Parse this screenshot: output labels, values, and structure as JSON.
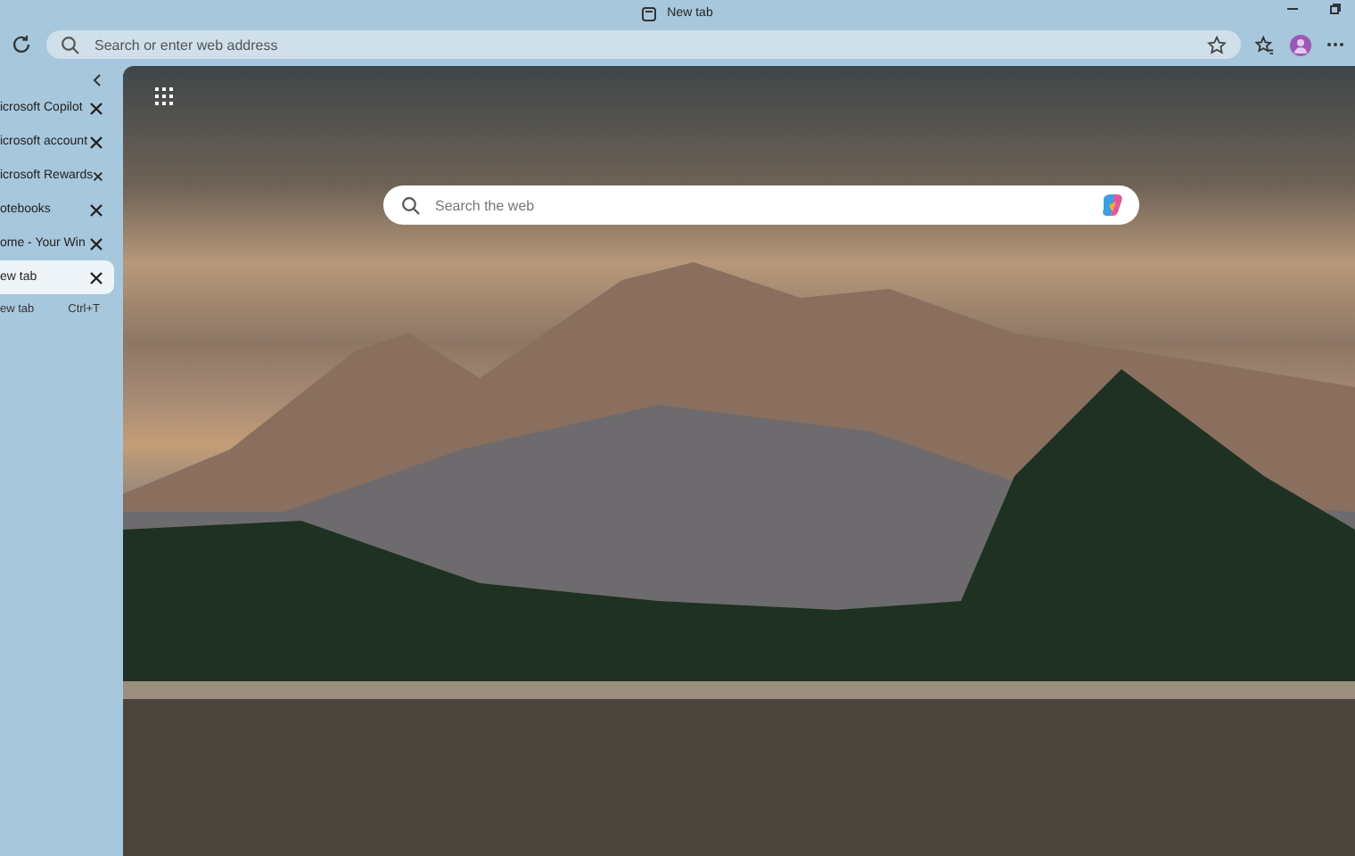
{
  "window": {
    "title": "New tab"
  },
  "address_bar": {
    "placeholder": "Search or enter web address"
  },
  "tabs": [
    {
      "label": "icrosoft Copilot",
      "selected": false
    },
    {
      "label": "icrosoft account",
      "selected": false
    },
    {
      "label": "icrosoft Rewards",
      "selected": false
    },
    {
      "label": "otebooks",
      "selected": false
    },
    {
      "label": "ome - Your Win",
      "selected": false
    },
    {
      "label": "ew tab",
      "selected": true
    }
  ],
  "new_tab": {
    "label": "ew tab",
    "shortcut": "Ctrl+T"
  },
  "page": {
    "search": {
      "placeholder": "Search the web"
    }
  }
}
